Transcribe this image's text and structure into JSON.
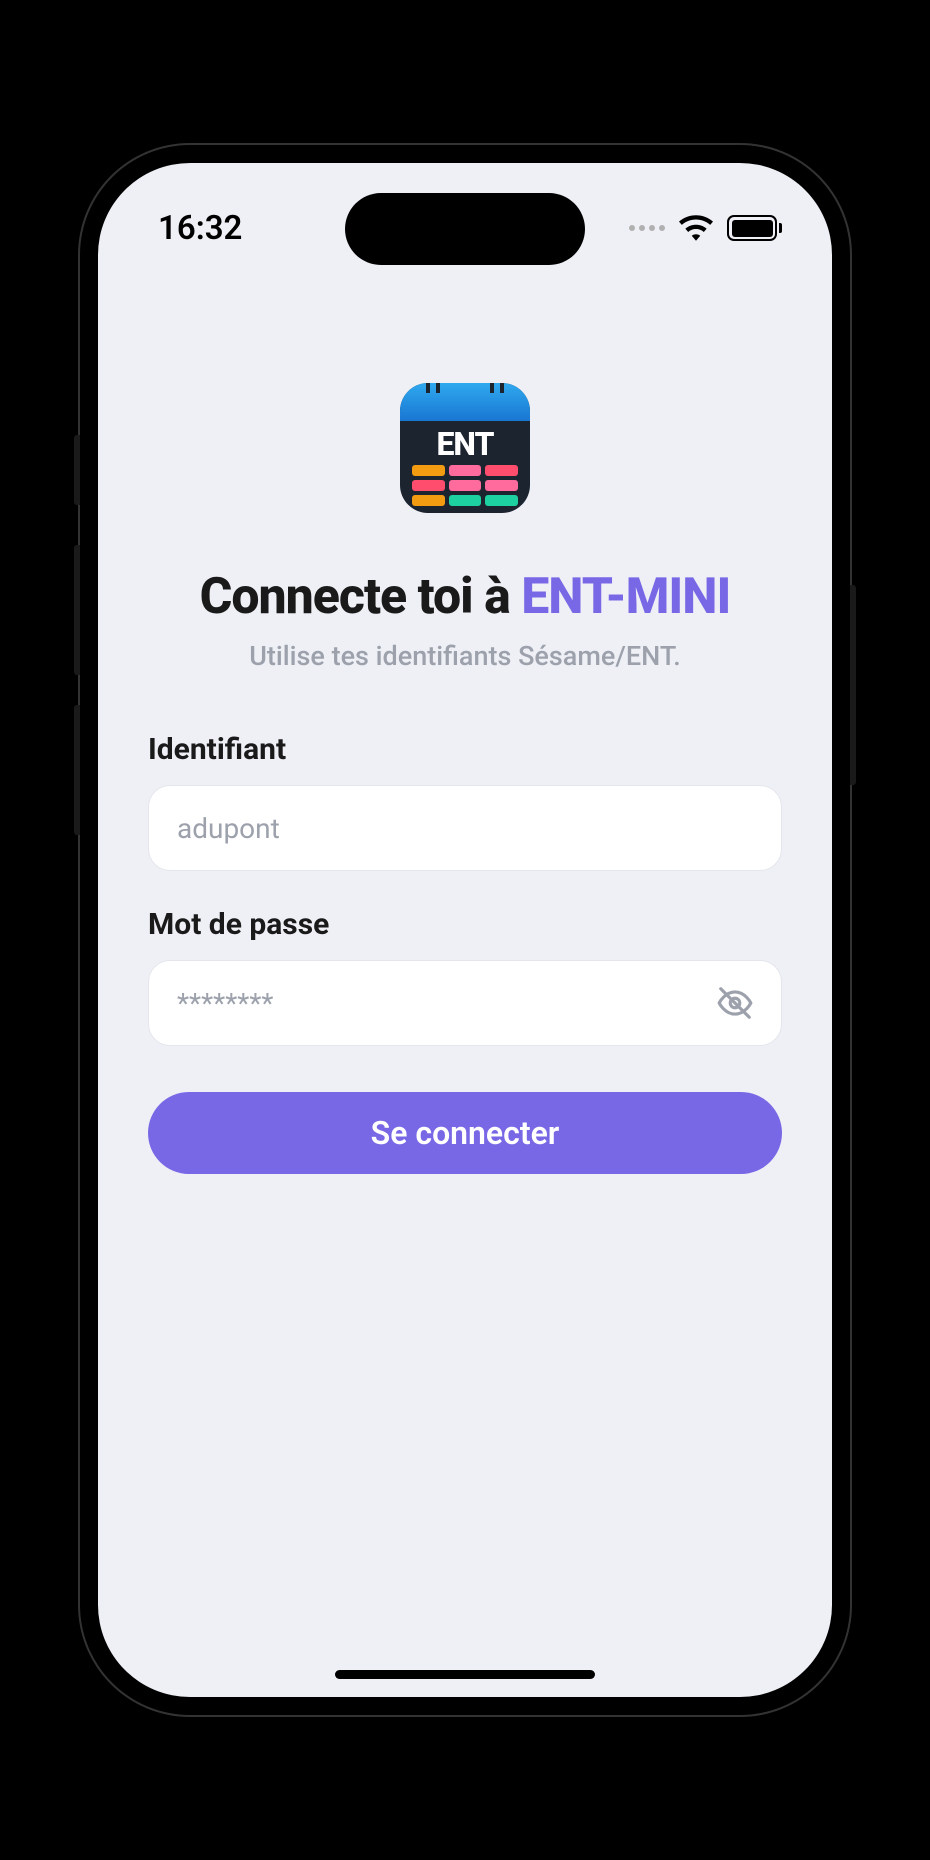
{
  "status_bar": {
    "time": "16:32"
  },
  "app": {
    "icon_text": "ENT"
  },
  "login": {
    "heading_prefix": "Connecte toi à ",
    "heading_accent": "ENT-MINI",
    "subheading": "Utilise tes identifiants Sésame/ENT.",
    "username_label": "Identifiant",
    "username_placeholder": "adupont",
    "username_value": "",
    "password_label": "Mot de passe",
    "password_placeholder": "********",
    "password_value": "",
    "submit_label": "Se connecter"
  },
  "colors": {
    "accent": "#7968e6",
    "background": "#eef0f6",
    "text_primary": "#1a1a1a",
    "text_muted": "#9ca1ac",
    "input_bg": "#ffffff",
    "input_border": "#e4e6ec"
  }
}
